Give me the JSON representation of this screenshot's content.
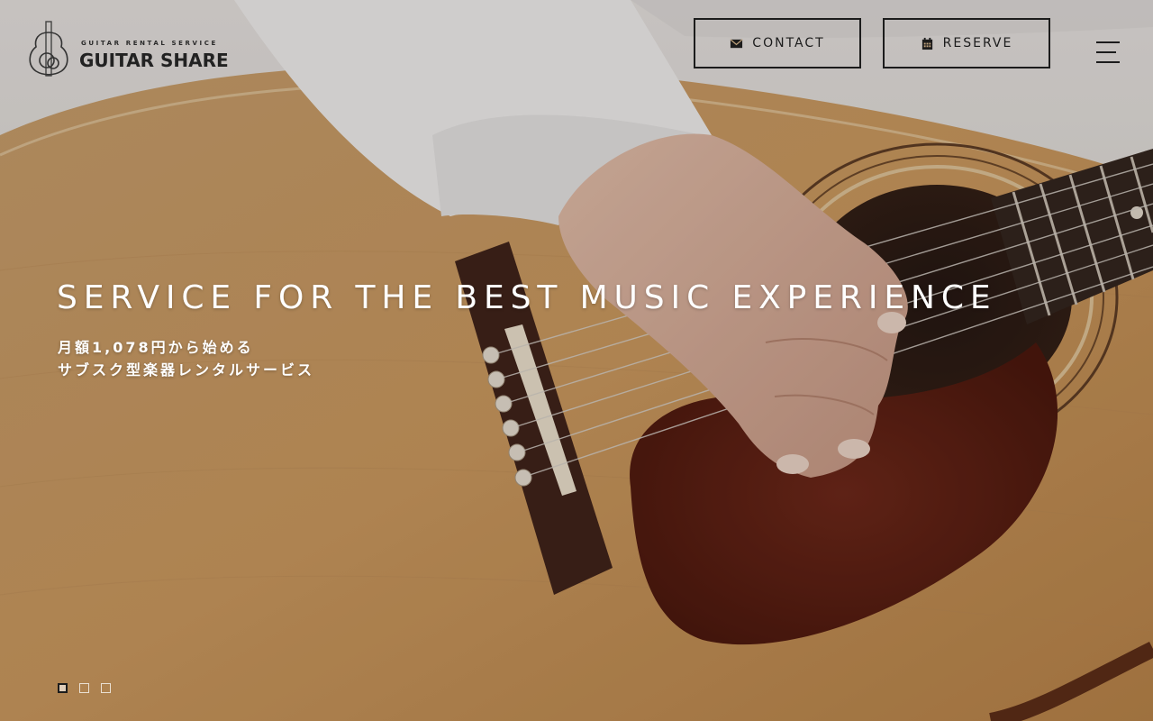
{
  "header": {
    "logo": {
      "tagline": "GUITAR RENTAL SERVICE",
      "name": "GUITAR SHARE",
      "icon": "guitar-logo-icon"
    },
    "buttons": [
      {
        "label": "CONTACT",
        "icon": "envelope-icon"
      },
      {
        "label": "RESERVE",
        "icon": "calendar-icon"
      }
    ],
    "menu_icon": "hamburger-menu-icon"
  },
  "hero": {
    "headline": "SERVICE FOR THE BEST MUSIC EXPERIENCE",
    "subcopy_line1": "月額1,078円から始める",
    "subcopy_line2": "サブスク型楽器レンタルサービス",
    "slides": {
      "count": 3,
      "active_index": 1
    }
  },
  "colors": {
    "text_light": "#ffffff",
    "text_dark": "#1c1c1c",
    "guitar_top": "#c9975d",
    "pickguard": "#5e1f14",
    "sleeve": "#f1f1f1"
  }
}
